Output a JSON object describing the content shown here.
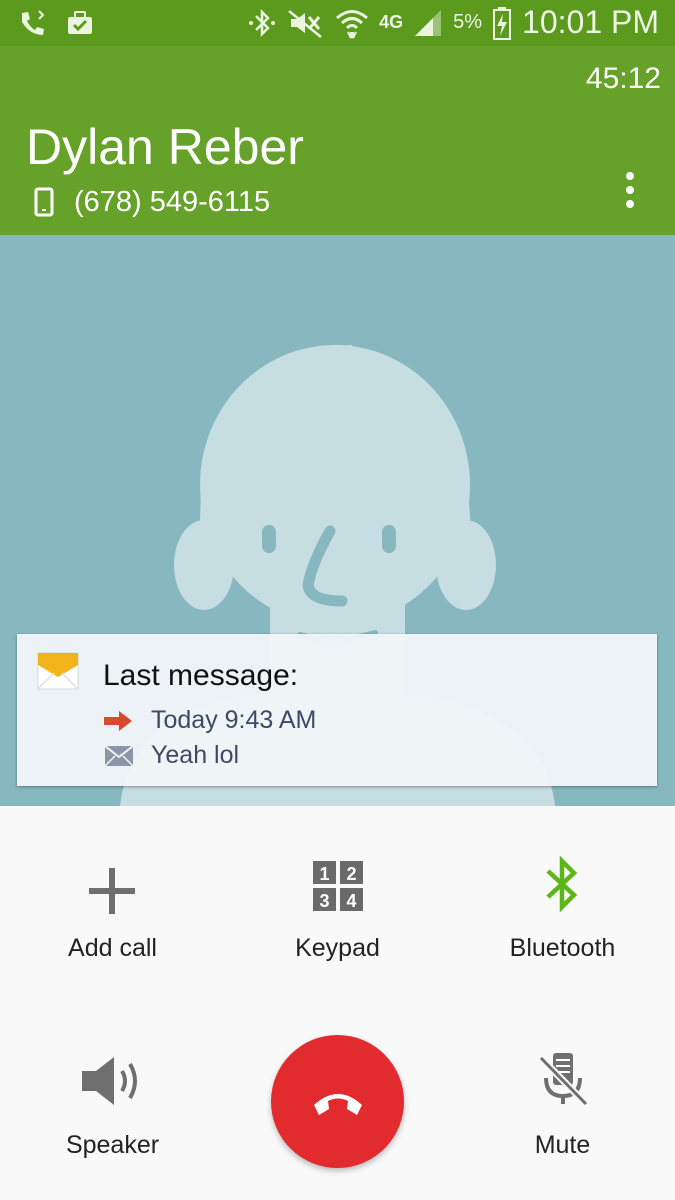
{
  "status_bar": {
    "network": "4G",
    "battery_percent": "5%",
    "time": "10:01 PM",
    "icons": [
      "call-icon",
      "briefcase-icon",
      "bluetooth-icon",
      "mute-icon",
      "wifi-icon",
      "signal-icon",
      "battery-icon"
    ]
  },
  "call": {
    "duration": "45:12",
    "name": "Dylan Reber",
    "number": "(678) 549-6115"
  },
  "message": {
    "title": "Last message:",
    "time": "Today 9:43 AM",
    "text": "Yeah lol"
  },
  "controls": {
    "add_call": "Add call",
    "keypad": "Keypad",
    "keypad_digits": [
      "1",
      "2",
      "3",
      "4"
    ],
    "bluetooth": "Bluetooth",
    "speaker": "Speaker",
    "mute": "Mute"
  },
  "colors": {
    "header": "#66a22a",
    "status_bar": "#5c9a1e",
    "end_call": "#e12b2f",
    "bluetooth_accent": "#5db617",
    "photo_bg": "#87b8c0"
  }
}
